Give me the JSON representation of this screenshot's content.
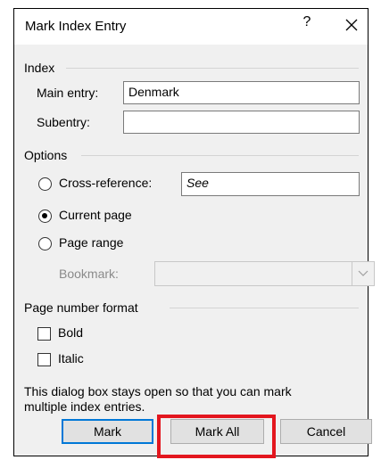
{
  "dialog": {
    "title": "Mark Index Entry",
    "help_glyph": "?",
    "close_icon": "close-icon"
  },
  "index": {
    "group_label": "Index",
    "main_entry_label": "Main entry:",
    "main_entry_value": "Denmark",
    "subentry_label": "Subentry:",
    "subentry_value": ""
  },
  "options": {
    "group_label": "Options",
    "cross_reference_label": "Cross-reference:",
    "cross_reference_value": "See",
    "current_page_label": "Current page",
    "page_range_label": "Page range",
    "bookmark_label": "Bookmark:",
    "bookmark_value": "",
    "selected": "current_page"
  },
  "page_number_format": {
    "group_label": "Page number format",
    "bold_label": "Bold",
    "italic_label": "Italic",
    "bold_checked": false,
    "italic_checked": false
  },
  "info_text_line1": "This dialog box stays open so that you can mark",
  "info_text_line2": "multiple index entries.",
  "buttons": {
    "mark_label": "Mark",
    "mark_all_label": "Mark All",
    "cancel_label": "Cancel"
  },
  "colors": {
    "default_button_border": "#0078d7",
    "highlight": "#e3161e",
    "dialog_background": "#f0f0f0"
  }
}
